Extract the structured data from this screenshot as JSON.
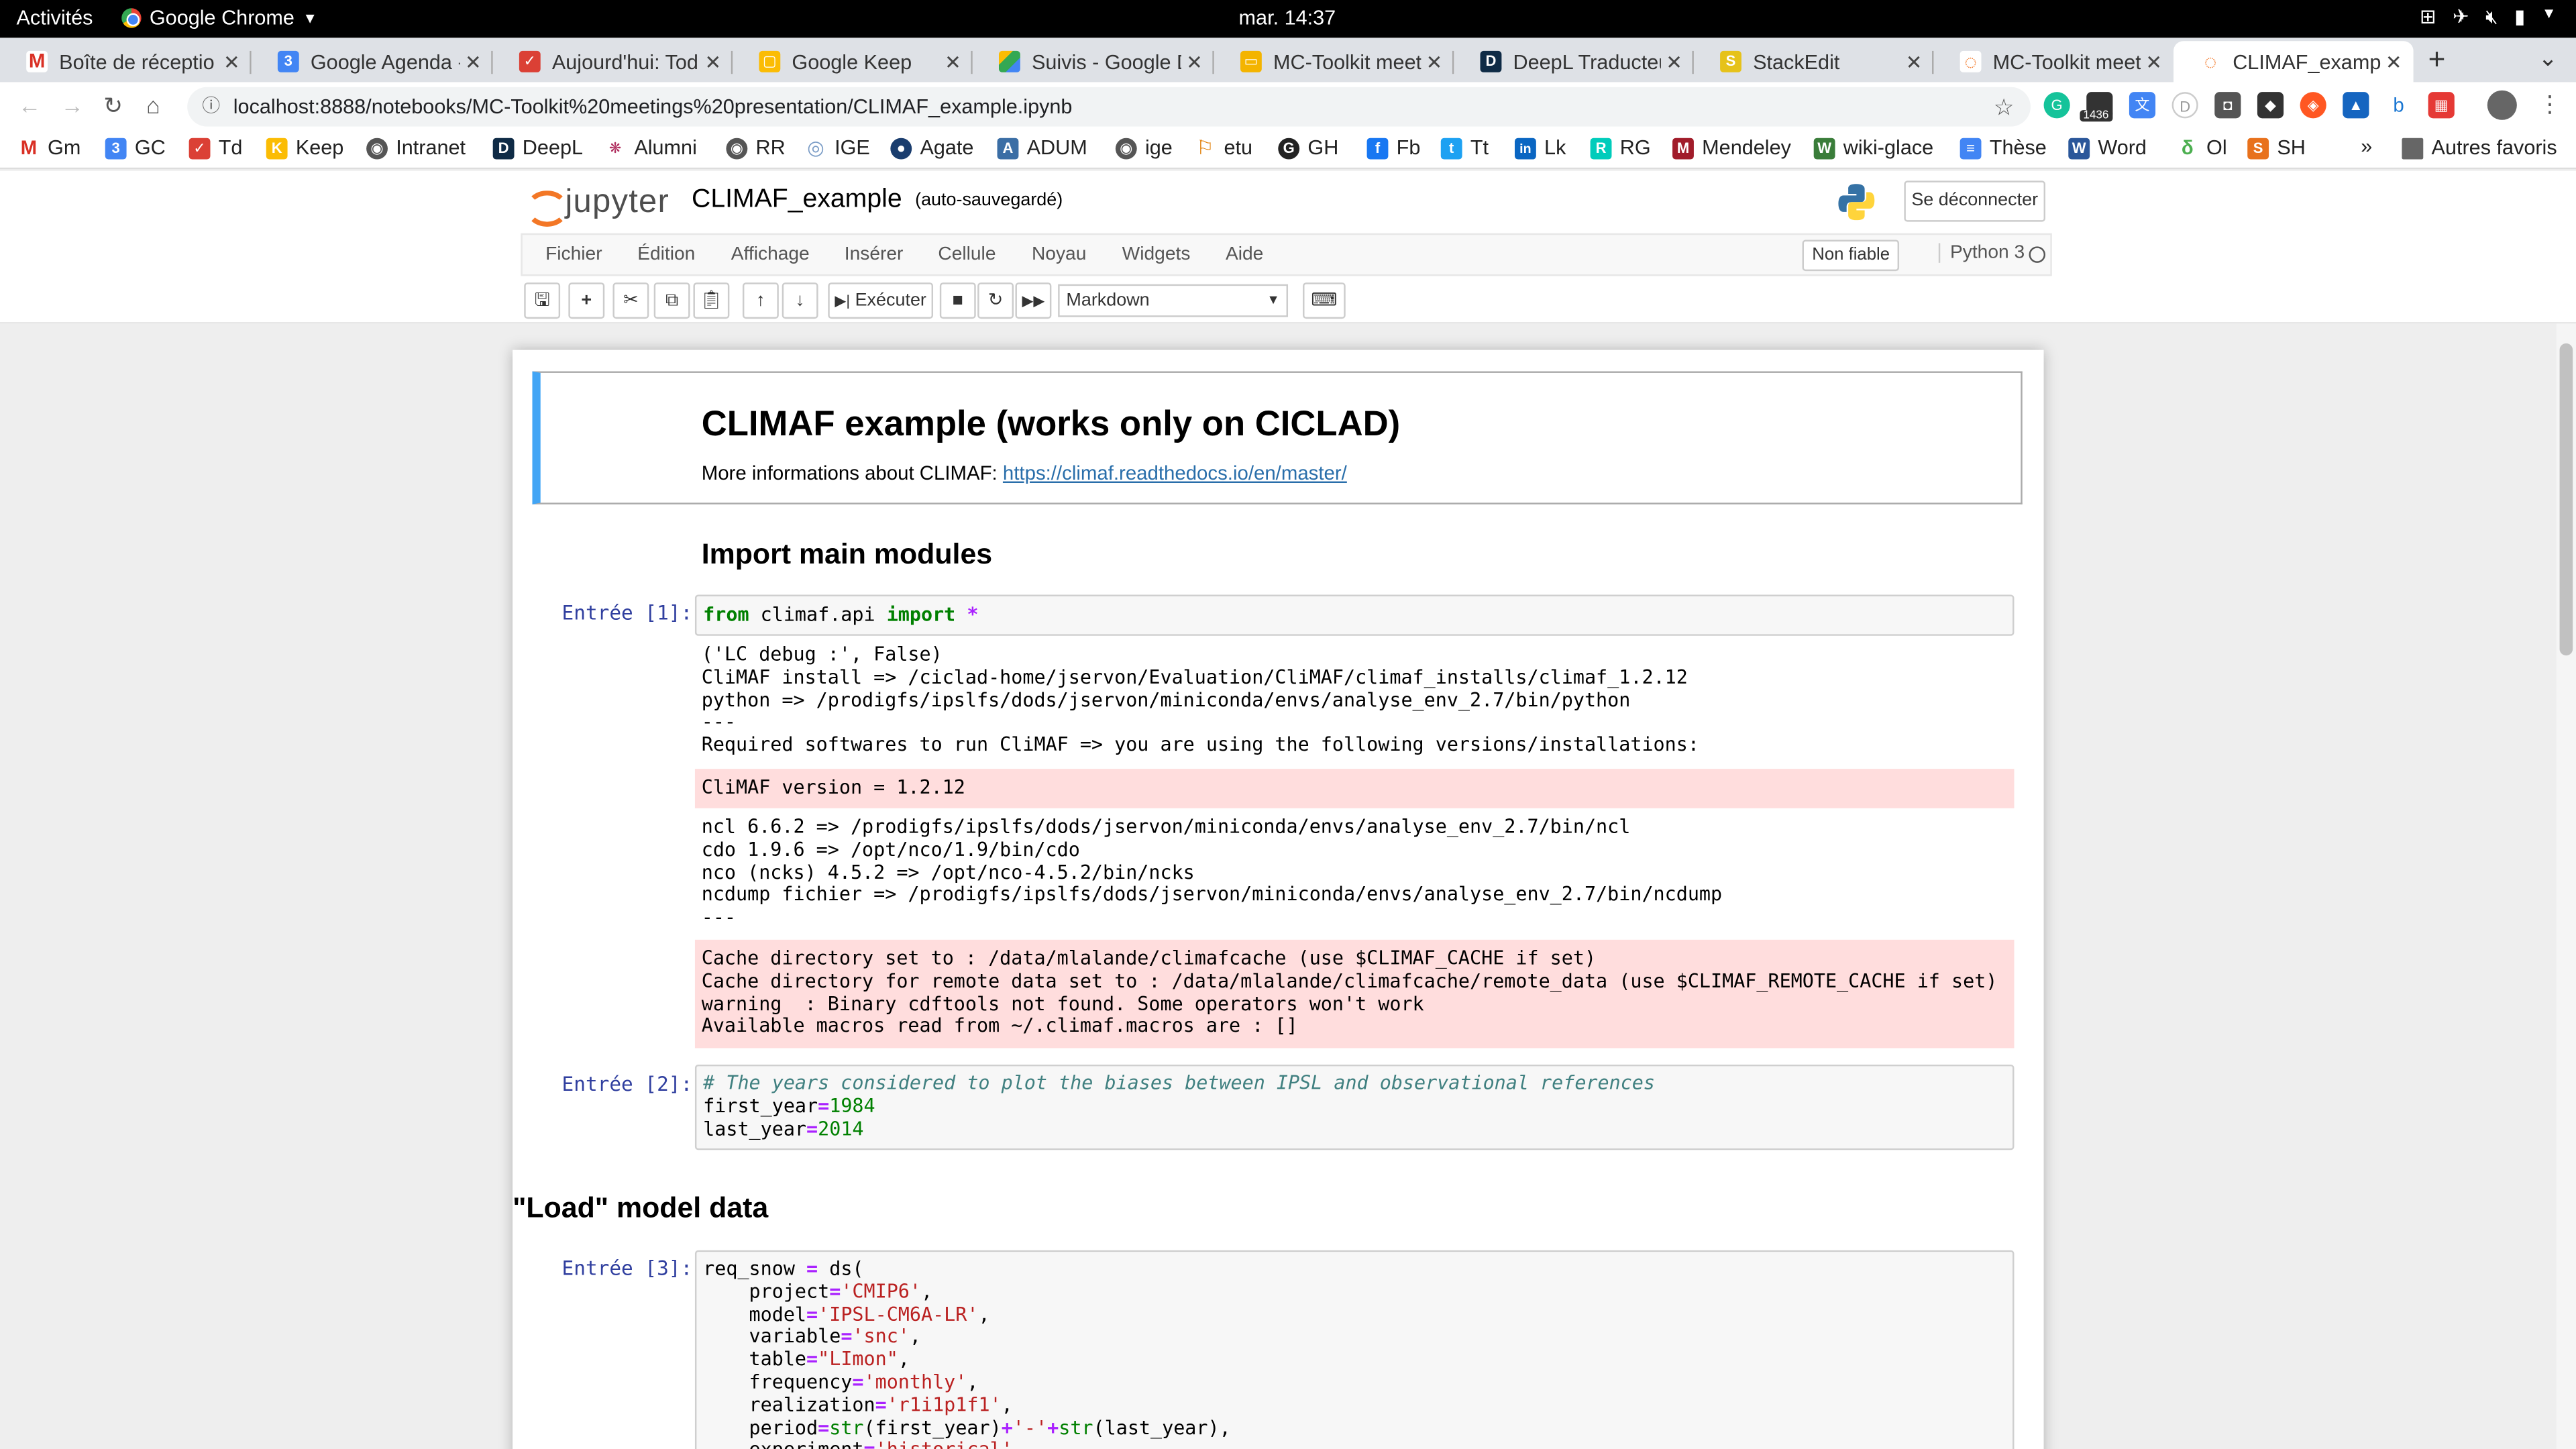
{
  "system": {
    "activities": "Activités",
    "app_name": "Google Chrome",
    "clock": "mar. 14:37"
  },
  "tabs": [
    {
      "label": "Boîte de réceptio",
      "icon": "gmail-icon",
      "color": "#d93025"
    },
    {
      "label": "Google Agenda -",
      "icon": "calendar-icon",
      "color": "#4285f4"
    },
    {
      "label": "Aujourd'hui: Tod",
      "icon": "todoist-icon",
      "color": "#db4035"
    },
    {
      "label": "Google Keep",
      "icon": "keep-icon",
      "color": "#fbbc04"
    },
    {
      "label": "Suivis - Google D",
      "icon": "drive-icon",
      "color": "#34a853"
    },
    {
      "label": "MC-Toolkit meet",
      "icon": "slides-icon",
      "color": "#f4b400"
    },
    {
      "label": "DeepL Traducteu",
      "icon": "deepl-icon",
      "color": "#0f2b46"
    },
    {
      "label": "StackEdit",
      "icon": "stackedit-icon",
      "color": "#e6c21a"
    },
    {
      "label": "MC-Toolkit meet",
      "icon": "jupyter-icon",
      "color": "#f37726"
    },
    {
      "label": "CLIMAF_exampl",
      "icon": "jupyter-icon",
      "color": "#f37726"
    }
  ],
  "address": {
    "url": "localhost:8888/notebooks/MC-Toolkit%20meetings%20presentation/CLIMAF_example.ipynb",
    "ext_badge": "1436"
  },
  "bookmarks": [
    {
      "label": "Gm",
      "color": "#d93025",
      "glyph": "M"
    },
    {
      "label": "GC",
      "color": "#4285f4",
      "glyph": "3"
    },
    {
      "label": "Td",
      "color": "#db4035",
      "glyph": "✓"
    },
    {
      "label": "Keep",
      "color": "#fbbc04",
      "glyph": "K"
    },
    {
      "label": "Intranet",
      "color": "#555555",
      "glyph": "◉"
    },
    {
      "label": "DeepL",
      "color": "#0f2b46",
      "glyph": "D"
    },
    {
      "label": "Alumni",
      "color": "#b03060",
      "glyph": "❋"
    },
    {
      "label": "RR",
      "color": "#555555",
      "glyph": "◉"
    },
    {
      "label": "IGE",
      "color": "#7a9cc6",
      "glyph": "◎"
    },
    {
      "label": "Agate",
      "color": "#1a3d6e",
      "glyph": "●"
    },
    {
      "label": "ADUM",
      "color": "#3b6ea5",
      "glyph": "A"
    },
    {
      "label": "ige",
      "color": "#555555",
      "glyph": "◉"
    },
    {
      "label": "etu",
      "color": "#e07b00",
      "glyph": "⚐"
    },
    {
      "label": "GH",
      "color": "#222222",
      "glyph": "G"
    },
    {
      "label": "Fb",
      "color": "#1877f2",
      "glyph": "f"
    },
    {
      "label": "Tt",
      "color": "#1da1f2",
      "glyph": "t"
    },
    {
      "label": "Lk",
      "color": "#0a66c2",
      "glyph": "in"
    },
    {
      "label": "RG",
      "color": "#00ccbb",
      "glyph": "R"
    },
    {
      "label": "Mendeley",
      "color": "#a11c2a",
      "glyph": "M"
    },
    {
      "label": "wiki-glace",
      "color": "#3a7d3a",
      "glyph": "W"
    },
    {
      "label": "Thèse",
      "color": "#4285f4",
      "glyph": "≡"
    },
    {
      "label": "Word",
      "color": "#2b579a",
      "glyph": "W"
    },
    {
      "label": "Ol",
      "color": "#4caf50",
      "glyph": "δ"
    },
    {
      "label": "SH",
      "color": "#e8711c",
      "glyph": "S"
    }
  ],
  "bookmarks_overflow": "»",
  "other_bookmarks": "Autres favoris",
  "jupyter": {
    "logo_text": "jupyter",
    "notebook_name": "CLIMAF_example",
    "autosave": "(auto-sauvegardé)",
    "logout": "Se déconnecter",
    "menu": [
      "Fichier",
      "Édition",
      "Affichage",
      "Insérer",
      "Cellule",
      "Noyau",
      "Widgets",
      "Aide"
    ],
    "trust": "Non fiable",
    "kernel": "Python 3",
    "run_label": "Exécuter",
    "cell_type": "Markdown"
  },
  "notebook": {
    "title": "CLIMAF example (works only on CICLAD)",
    "intro_text": "More informations about CLIMAF:",
    "intro_link": "https://climaf.readthedocs.io/en/master/",
    "h_import": "Import main modules",
    "h_load": "\"Load\" model data",
    "prompt1": "Entrée [1]:",
    "prompt2": "Entrée [2]:",
    "prompt3": "Entrée [3]:",
    "out1_lines": [
      "('LC debug :', False)",
      "CliMAF install => /ciclad-home/jservon/Evaluation/CliMAF/climaf_installs/climaf_1.2.12",
      "python => /prodigfs/ipslfs/dods/jservon/miniconda/envs/analyse_env_2.7/bin/python",
      "---",
      "Required softwares to run CliMAF => you are using the following versions/installations:"
    ],
    "err1": "CliMAF version = 1.2.12",
    "out2_lines": [
      "ncl 6.6.2 => /prodigfs/ipslfs/dods/jservon/miniconda/envs/analyse_env_2.7/bin/ncl",
      "cdo 1.9.6 => /opt/nco/1.9/bin/cdo",
      "nco (ncks) 4.5.2 => /opt/nco-4.5.2/bin/ncks",
      "ncdump fichier => /prodigfs/ipslfs/dods/jservon/miniconda/envs/analyse_env_2.7/bin/ncdump",
      "---"
    ],
    "err2_lines": [
      "Cache directory set to : /data/mlalande/climafcache (use $CLIMAF_CACHE if set)",
      "Cache directory for remote data set to : /data/mlalande/climafcache/remote_data (use $CLIMAF_REMOTE_CACHE if set)",
      "warning  : Binary cdftools not found. Some operators won't work",
      "Available macros read from ~/.climaf.macros are : []"
    ],
    "code2_comment": "# The years considered to plot the biases between IPSL and observational references",
    "first_year": "1984",
    "last_year": "2014",
    "snow_args": {
      "project": "'CMIP6'",
      "model": "'IPSL-CM6A-LR'",
      "variable": "'snc'",
      "table": "\"LImon\"",
      "frequency": "'monthly'",
      "realization": "'r1i1p1f1'",
      "experiment": "'historical'"
    }
  }
}
